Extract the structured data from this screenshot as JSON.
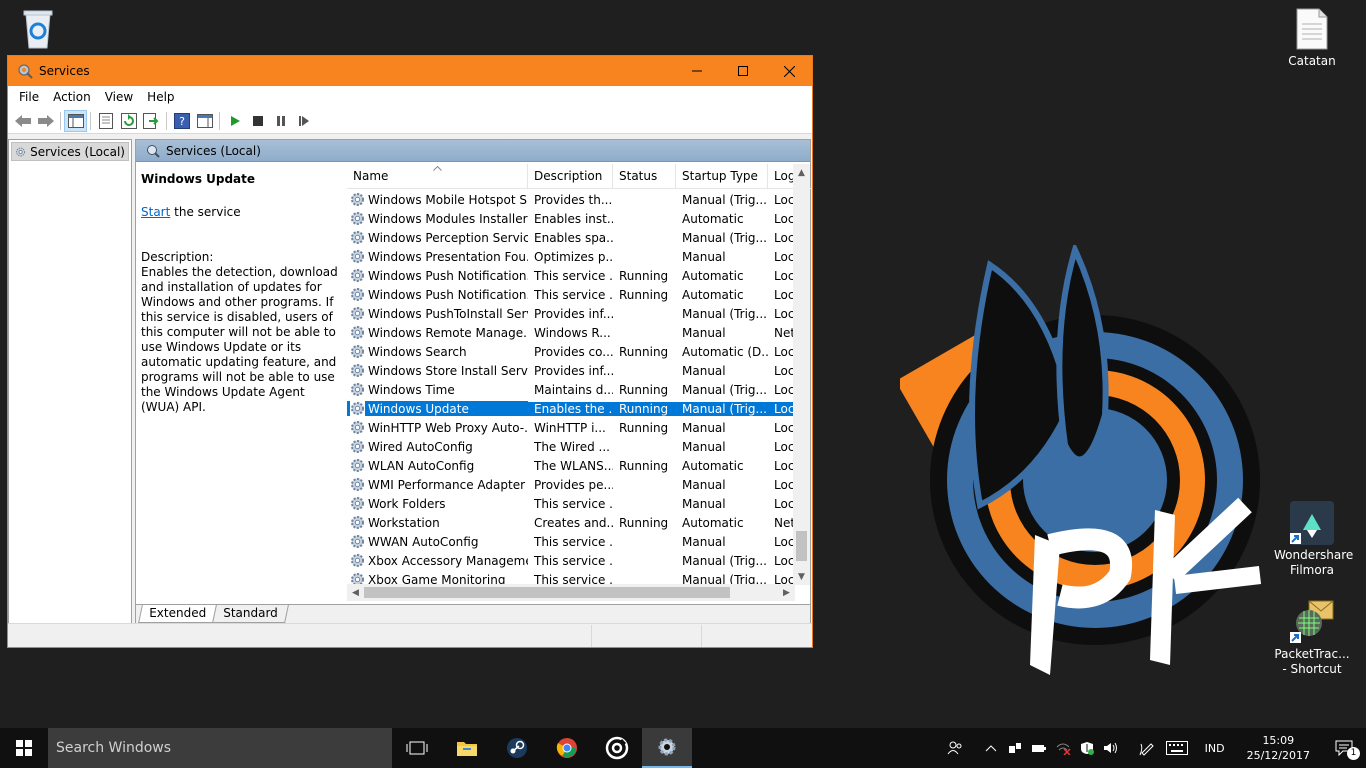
{
  "desktop": {
    "icons": [
      {
        "label": "Catatan"
      },
      {
        "label": "Wondershare Filmora"
      },
      {
        "label": "PacketTrac... - Shortcut"
      }
    ]
  },
  "window": {
    "title": "Services",
    "menu": [
      "File",
      "Action",
      "View",
      "Help"
    ],
    "tree_item": "Services (Local)",
    "pane_header": "Services (Local)",
    "selected_service": "Windows Update",
    "start_link": "Start",
    "start_suffix": " the service",
    "description_label": "Description:",
    "description_text": "Enables the detection, download and installation of updates for Windows and other programs. If this service is disabled, users of this computer will not be able to use Windows Update or its automatic updating feature, and programs will not be able to use the Windows Update Agent (WUA) API.",
    "columns": [
      "Name",
      "Description",
      "Status",
      "Startup Type",
      "Log"
    ],
    "rows": [
      {
        "name": "Windows Mobile Hotspot S...",
        "desc": "Provides th...",
        "status": "",
        "startup": "Manual (Trig...",
        "log": "Loc"
      },
      {
        "name": "Windows Modules Installer",
        "desc": "Enables inst...",
        "status": "",
        "startup": "Automatic",
        "log": "Loc"
      },
      {
        "name": "Windows Perception Service",
        "desc": "Enables spa...",
        "status": "",
        "startup": "Manual (Trig...",
        "log": "Loc"
      },
      {
        "name": "Windows Presentation Fou...",
        "desc": "Optimizes p...",
        "status": "",
        "startup": "Manual",
        "log": "Loc"
      },
      {
        "name": "Windows Push Notification...",
        "desc": "This service ...",
        "status": "Running",
        "startup": "Automatic",
        "log": "Loc"
      },
      {
        "name": "Windows Push Notification...",
        "desc": "This service ...",
        "status": "Running",
        "startup": "Automatic",
        "log": "Loc"
      },
      {
        "name": "Windows PushToInstall Serv...",
        "desc": "Provides inf...",
        "status": "",
        "startup": "Manual (Trig...",
        "log": "Loc"
      },
      {
        "name": "Windows Remote Manage...",
        "desc": "Windows R...",
        "status": "",
        "startup": "Manual",
        "log": "Net"
      },
      {
        "name": "Windows Search",
        "desc": "Provides co...",
        "status": "Running",
        "startup": "Automatic (D...",
        "log": "Loc"
      },
      {
        "name": "Windows Store Install Service",
        "desc": "Provides inf...",
        "status": "",
        "startup": "Manual",
        "log": "Loc"
      },
      {
        "name": "Windows Time",
        "desc": "Maintains d...",
        "status": "Running",
        "startup": "Manual (Trig...",
        "log": "Loc"
      },
      {
        "name": "Windows Update",
        "desc": "Enables the ...",
        "status": "Running",
        "startup": "Manual (Trig...",
        "log": "Loc",
        "selected": true
      },
      {
        "name": "WinHTTP Web Proxy Auto-...",
        "desc": "WinHTTP i...",
        "status": "Running",
        "startup": "Manual",
        "log": "Loc"
      },
      {
        "name": "Wired AutoConfig",
        "desc": "The Wired ...",
        "status": "",
        "startup": "Manual",
        "log": "Loc"
      },
      {
        "name": "WLAN AutoConfig",
        "desc": "The WLANS...",
        "status": "Running",
        "startup": "Automatic",
        "log": "Loc"
      },
      {
        "name": "WMI Performance Adapter",
        "desc": "Provides pe...",
        "status": "",
        "startup": "Manual",
        "log": "Loc"
      },
      {
        "name": "Work Folders",
        "desc": "This service ...",
        "status": "",
        "startup": "Manual",
        "log": "Loc"
      },
      {
        "name": "Workstation",
        "desc": "Creates and...",
        "status": "Running",
        "startup": "Automatic",
        "log": "Net"
      },
      {
        "name": "WWAN AutoConfig",
        "desc": "This service ...",
        "status": "",
        "startup": "Manual",
        "log": "Loc"
      },
      {
        "name": "Xbox Accessory Manageme...",
        "desc": "This service ...",
        "status": "",
        "startup": "Manual (Trig...",
        "log": "Loc"
      },
      {
        "name": "Xbox Game Monitoring",
        "desc": "This service ...",
        "status": "",
        "startup": "Manual (Trig...",
        "log": "Loc"
      }
    ],
    "tabs": [
      "Extended",
      "Standard"
    ]
  },
  "taskbar": {
    "search_placeholder": "Search Windows",
    "language": "IND",
    "time": "15:09",
    "date": "25/12/2017",
    "notification_count": "1"
  },
  "colors": {
    "title_bar": "#f7841f",
    "selection": "#0078d7",
    "link": "#0066cc"
  }
}
